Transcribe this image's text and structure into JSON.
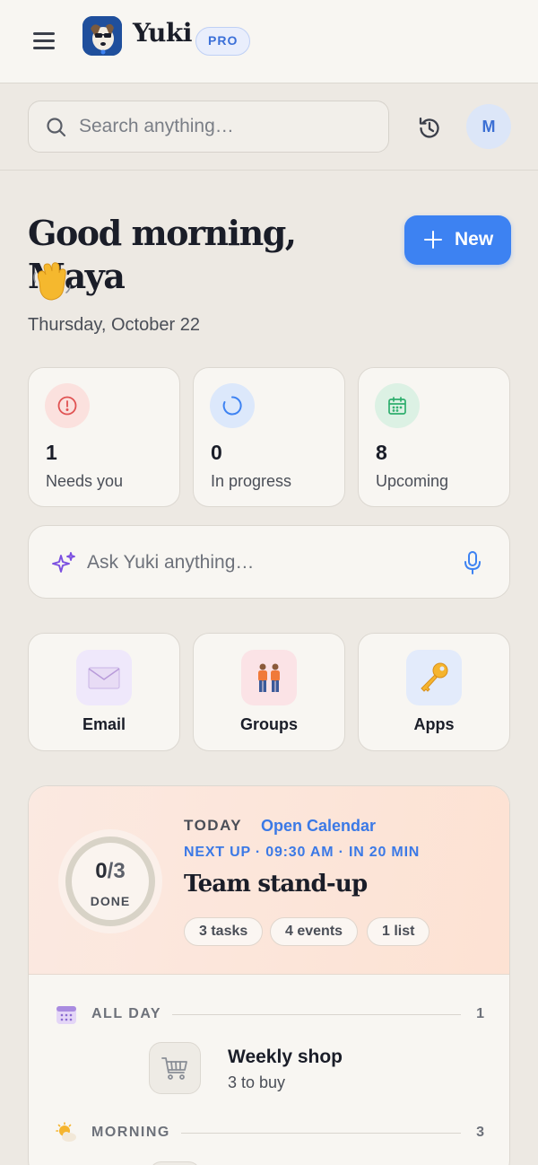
{
  "header": {
    "brand_name": "Yuki",
    "badge": "PRO"
  },
  "search": {
    "placeholder": "Search anything…"
  },
  "user": {
    "initial": "M"
  },
  "greeting": {
    "text": "Good morning, Maya",
    "emoji": "👋",
    "date": "Thursday, October 22"
  },
  "new_button": {
    "label": "New"
  },
  "stats": [
    {
      "count": "1",
      "label": "Needs you",
      "icon": "alert-icon",
      "color": "#e05252"
    },
    {
      "count": "0",
      "label": "In progress",
      "icon": "progress-icon",
      "color": "#3d82f2"
    },
    {
      "count": "8",
      "label": "Upcoming",
      "icon": "calendar-icon",
      "color": "#2fae6e"
    }
  ],
  "ask": {
    "placeholder": "Ask Yuki anything…"
  },
  "tiles": [
    {
      "label": "Email",
      "icon": "envelope-icon"
    },
    {
      "label": "Groups",
      "icon": "people-icon"
    },
    {
      "label": "Apps",
      "icon": "key-icon"
    }
  ],
  "today": {
    "label": "TODAY",
    "open_calendar": "Open Calendar",
    "done_count": "0",
    "total_count": "3",
    "done_label": "DONE",
    "next_up": "NEXT UP · 09:30 AM · IN 20 MIN",
    "event_title": "Team stand-up",
    "chips": [
      "3 tasks",
      "4 events",
      "1 list"
    ],
    "sections": [
      {
        "label": "ALL DAY",
        "count": "1",
        "icon": "calendar-grid-icon"
      },
      {
        "label": "MORNING",
        "count": "3",
        "icon": "sun-cloud-icon"
      }
    ],
    "items": [
      {
        "title": "Weekly shop",
        "subtitle": "3 to buy",
        "icon": "shopping-cart-icon"
      }
    ]
  },
  "colors": {
    "accent": "#3d82f2",
    "background": "#ede9e3",
    "card": "#f8f6f2"
  }
}
